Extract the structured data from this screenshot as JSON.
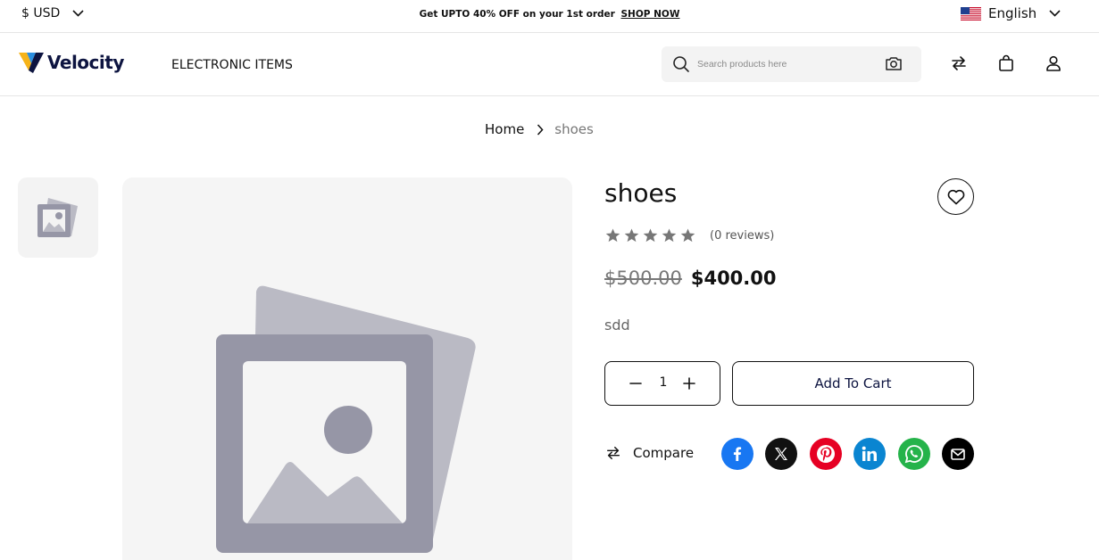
{
  "topbar": {
    "currency": "$ USD",
    "promo_text": "Get UPTO 40% OFF on your 1st order",
    "promo_link": "SHOP NOW",
    "language": "English"
  },
  "header": {
    "logo_text": "Velocity",
    "nav_item": "ELECTRONIC ITEMS",
    "search_placeholder": "Search products here"
  },
  "breadcrumb": {
    "home": "Home",
    "current": "shoes"
  },
  "product": {
    "title": "shoes",
    "reviews": "(0 reviews)",
    "rating": 0,
    "rating_max": 5,
    "price_old": "$500.00",
    "price_new": "$400.00",
    "description": "sdd",
    "quantity": "1",
    "add_to_cart": "Add To Cart",
    "compare": "Compare"
  },
  "social": [
    "facebook-icon",
    "x-icon",
    "pinterest-icon",
    "linkedin-icon",
    "whatsapp-icon",
    "email-icon"
  ],
  "colors": {
    "brand_navy": "#0d1440",
    "logo_yellow": "#f6b319",
    "logo_blue": "#2a8ee0",
    "placeholder_dark": "#9696a6",
    "placeholder_light": "#babac4",
    "facebook": "#1877f2",
    "x": "#111111",
    "pinterest": "#e60023",
    "linkedin": "#0a85d1",
    "whatsapp": "#25b34a",
    "email": "#000000"
  }
}
